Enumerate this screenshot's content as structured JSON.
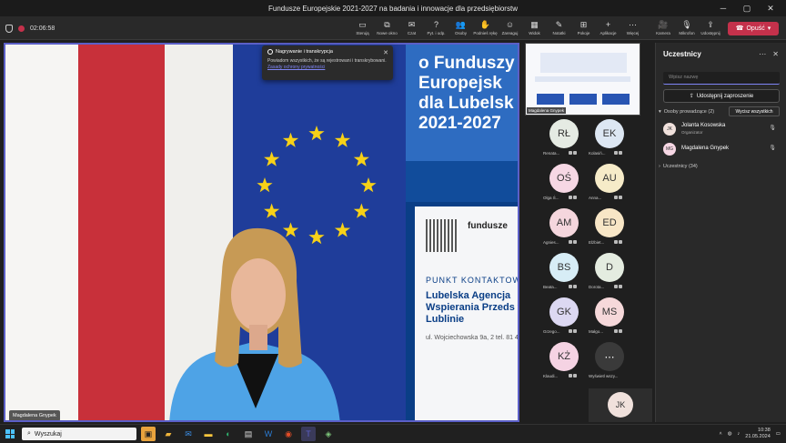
{
  "window": {
    "title": "Fundusze Europejskie 2021-2027 na badania i innowacje dla przedsiębiorstw"
  },
  "toolbar": {
    "timer": "02:06:58",
    "items": [
      {
        "label": "Sterują",
        "icon": "▭"
      },
      {
        "label": "Nowe okno",
        "icon": "⧉"
      },
      {
        "label": "Czat",
        "icon": "✉"
      },
      {
        "label": "Pyt. i odp.",
        "icon": "?"
      },
      {
        "label": "Osoby",
        "icon": "👥",
        "count": "36"
      },
      {
        "label": "Podnieś rękę",
        "icon": "✋"
      },
      {
        "label": "Zareaguj",
        "icon": "☺"
      },
      {
        "label": "Widok",
        "icon": "▦"
      },
      {
        "label": "Notatki",
        "icon": "✎"
      },
      {
        "label": "Pokoje",
        "icon": "⊞"
      },
      {
        "label": "Aplikacje",
        "icon": "+"
      },
      {
        "label": "Więcej",
        "icon": "⋯"
      }
    ],
    "media": [
      {
        "label": "Kamera",
        "icon": "🎥"
      },
      {
        "label": "Mikrofon",
        "icon": "🎙"
      },
      {
        "label": "Udostępnij",
        "icon": "⇪"
      }
    ],
    "leave_label": "Opuść"
  },
  "notice": {
    "title": "Nagrywanie i transkrypcja",
    "body": "Powiadom wszystkich, że są rejestrowani i transkrybowani.",
    "link": "Zasady ochrony prywatności"
  },
  "stage": {
    "speaker_name": "Magdalena Gnypek",
    "banner_title": "o Funduszy Europejsk dla Lubelsk 2021-2027",
    "banner_brand": "fundusze",
    "banner_contact": "PUNKT KONTAKTOW",
    "banner_agency": "Lubelska Agencja Wspierania Przeds w Lublinie",
    "banner_address": "ul. Wojciechowska 9a, 2 tel. 81 462 38 12 lub 81 e-mail: lawp@lubelskie."
  },
  "share_thumb": {
    "presenter": "Magdalena Gnypek"
  },
  "tiles": [
    {
      "initials": "RŁ",
      "name": "Renata...",
      "color": "#e5ebe3"
    },
    {
      "initials": "EK",
      "name": "Kolasiń...",
      "color": "#dde7f3"
    },
    {
      "initials": "OŚ",
      "name": "Olga Ś...",
      "color": "#f6d7e4"
    },
    {
      "initials": "AU",
      "name": "Anna...",
      "color": "#f6ebc8"
    },
    {
      "initials": "AM",
      "name": "Agnies...",
      "color": "#f5d6dd"
    },
    {
      "initials": "ED",
      "name": "Elżbiet...",
      "color": "#f8e6c6"
    },
    {
      "initials": "BS",
      "name": "Beata...",
      "color": "#d7edf6"
    },
    {
      "initials": "D",
      "name": "Dorota...",
      "color": "#e4ece0"
    },
    {
      "initials": "GK",
      "name": "Grzego...",
      "color": "#dcd8f2"
    },
    {
      "initials": "MS",
      "name": "Małgo...",
      "color": "#f6d8da"
    },
    {
      "initials": "KŻ",
      "name": "Klaudi...",
      "color": "#f5d3e3"
    },
    {
      "initials": "⋯",
      "name": "Wyświetl wszy...",
      "color": "#3a3a3a"
    }
  ],
  "jk_tile": {
    "initials": "JK"
  },
  "panel": {
    "title": "Uczestnicy",
    "search_placeholder": "Wpisz nazwę",
    "share_invite": "Udostępnij zaproszenie",
    "organizers_label": "Osoby prowadzące (2)",
    "mute_all": "Wycisz wszystkich",
    "attendees_label": "Uczestnicy (34)",
    "people": [
      {
        "initials": "JK",
        "name": "Jolanta Kosowska",
        "role": "Organizator",
        "color": "#f0e1dc"
      },
      {
        "initials": "MG",
        "name": "Magdalena Gnypek",
        "role": "",
        "color": "#f6d7e4"
      }
    ]
  },
  "taskbar": {
    "search_label": "Wyszukaj",
    "time": "10:38",
    "date": "21.05.2024"
  }
}
